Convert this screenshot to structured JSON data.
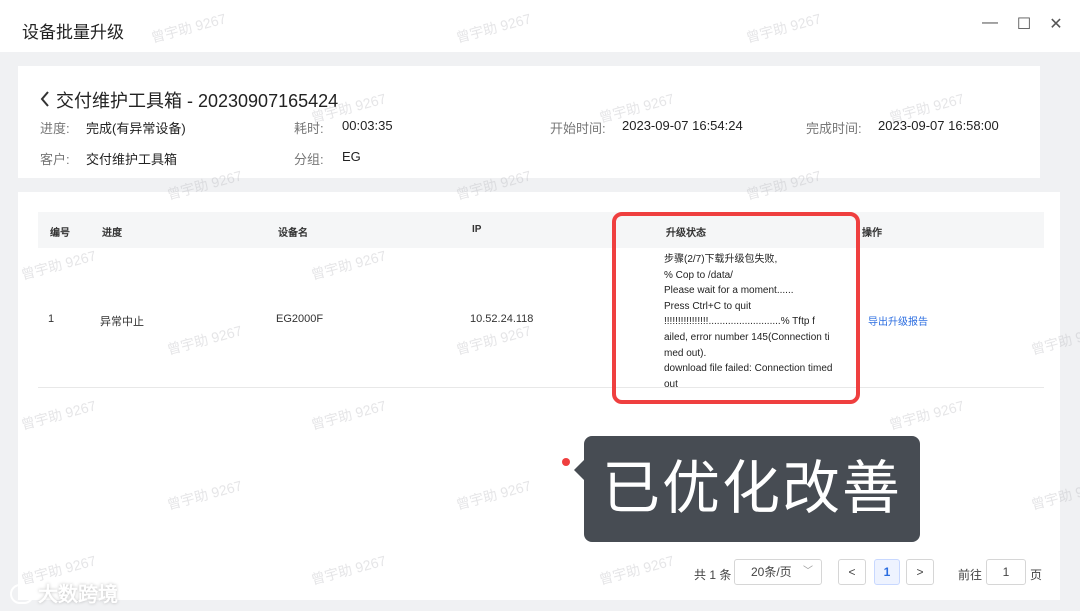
{
  "window": {
    "title": "设备批量升级",
    "controls": [
      "—",
      "☐",
      "✕"
    ]
  },
  "task": {
    "back_title": "交付维护工具箱 - 20230907165424",
    "progress_label": "进度:",
    "progress_value": "完成(有异常设备)",
    "elapsed_label": "耗时:",
    "elapsed_value": "00:03:35",
    "start_label": "开始时间:",
    "start_value": "2023-09-07 16:54:24",
    "end_label": "完成时间:",
    "end_value": "2023-09-07 16:58:00",
    "customer_label": "客户:",
    "customer_value": "交付维护工具箱",
    "group_label": "分组:",
    "group_value": "EG"
  },
  "table": {
    "headers": [
      "编号",
      "进度",
      "设备名",
      "IP",
      "升级状态",
      "操作"
    ],
    "rows": [
      {
        "no": "1",
        "progress": "异常中止",
        "device": "EG2000F",
        "ip": "10.52.24.118",
        "status_lines": [
          "步骤(2/7)下载升级包失败,",
          "% Cop to /data/",
          "Please wait for a moment......",
          "Press Ctrl+C to quit",
          "!!!!!!!!!!!!!!!!..........................% Tftp f",
          "ailed, error number 145(Connection ti",
          "med out).",
          "download file failed: Connection timed",
          "out"
        ],
        "action": "导出升级报告"
      }
    ]
  },
  "callout": {
    "text": "已优化改善"
  },
  "pagination": {
    "total": "共 1 条",
    "page_size": "20条/页",
    "prev": "<",
    "current": "1",
    "next": ">",
    "goto_label": "前往",
    "goto_value": "1",
    "page_unit": "页"
  },
  "watermark": {
    "text": "曾宇助 9267"
  },
  "brand": {
    "text": "大数跨境"
  },
  "colors": {
    "highlight": "#ef3f3f",
    "link": "#2b6de0",
    "callout_bg": "#474c53"
  }
}
